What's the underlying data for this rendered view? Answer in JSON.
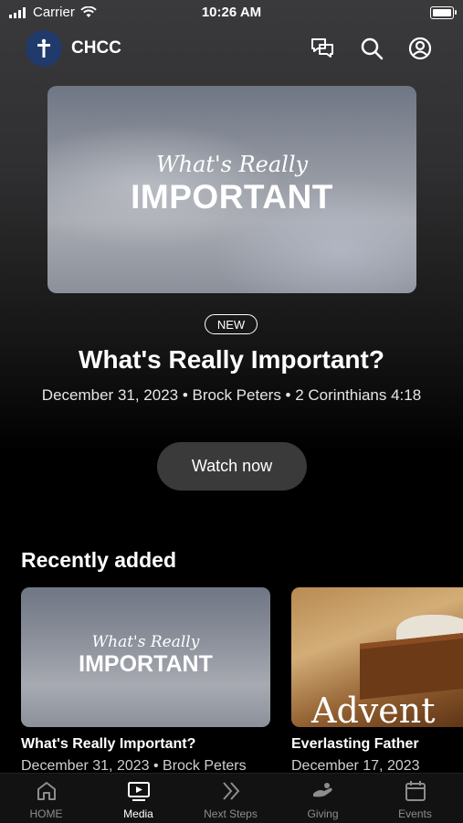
{
  "status": {
    "carrier": "Carrier",
    "time": "10:26 AM"
  },
  "header": {
    "brand": "CHCC"
  },
  "hero": {
    "image_script": "What's Really",
    "image_title": "IMPORTANT",
    "badge": "NEW",
    "title": "What's Really Important?",
    "meta": "December 31, 2023 • Brock Peters • 2 Corinthians 4:18",
    "cta": "Watch now"
  },
  "recent": {
    "heading": "Recently added",
    "items": [
      {
        "image_script": "What's Really",
        "image_title": "IMPORTANT",
        "title": "What's Really Important?",
        "meta": "December 31, 2023 • Brock Peters"
      },
      {
        "image_title": "Advent",
        "title": "Everlasting Father",
        "meta": "December 17, 2023"
      }
    ]
  },
  "tabs": [
    {
      "label": "HOME",
      "icon": "home-icon"
    },
    {
      "label": "Media",
      "icon": "media-icon",
      "active": true
    },
    {
      "label": "Next Steps",
      "icon": "next-steps-icon"
    },
    {
      "label": "Giving",
      "icon": "giving-icon"
    },
    {
      "label": "Events",
      "icon": "events-icon"
    }
  ],
  "colors": {
    "logo_bg": "#1f3a6b",
    "button_bg": "#3a3a3a",
    "tab_inactive": "#8d8d8d"
  }
}
